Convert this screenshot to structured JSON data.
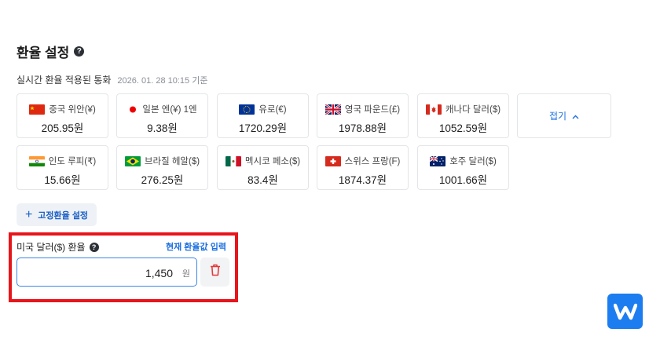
{
  "header": {
    "title": "환율 설정",
    "help_icon": "question-icon"
  },
  "realtime": {
    "label": "실시간 환율 적용된 통화",
    "timestamp": "2026. 01. 28 10:15 기준"
  },
  "currencies": [
    {
      "flag": "china-flag-icon",
      "name": "중국 위안(¥)",
      "value": "205.95원"
    },
    {
      "flag": "japan-flag-icon",
      "name": "일본 엔(¥) 1엔",
      "value": "9.38원"
    },
    {
      "flag": "eu-flag-icon",
      "name": "유로(€)",
      "value": "1720.29원"
    },
    {
      "flag": "uk-flag-icon",
      "name": "영국 파운드(£)",
      "value": "1978.88원"
    },
    {
      "flag": "canada-flag-icon",
      "name": "캐나다 달러($)",
      "value": "1052.59원"
    },
    {
      "flag": "india-flag-icon",
      "name": "인도 루피(₹)",
      "value": "15.66원"
    },
    {
      "flag": "brazil-flag-icon",
      "name": "브라질 헤알($)",
      "value": "276.25원"
    },
    {
      "flag": "mexico-flag-icon",
      "name": "멕시코 페소($)",
      "value": "83.4원"
    },
    {
      "flag": "switzerland-flag-icon",
      "name": "스위스 프랑(F)",
      "value": "1874.37원"
    },
    {
      "flag": "australia-flag-icon",
      "name": "호주 달러($)",
      "value": "1001.66원"
    }
  ],
  "collapse": {
    "label": "접기"
  },
  "fixed_rate": {
    "button_label": "고정환율 설정"
  },
  "usd": {
    "label": "미국 달러($) 환율",
    "current_rate_link": "현재 환율값 입력",
    "input_value": "1,450",
    "unit": "원"
  },
  "colors": {
    "accent": "#1b6fe0",
    "highlight_border": "#e8151b",
    "delete_icon": "#e23b3b",
    "brand": "#1c7df0"
  }
}
